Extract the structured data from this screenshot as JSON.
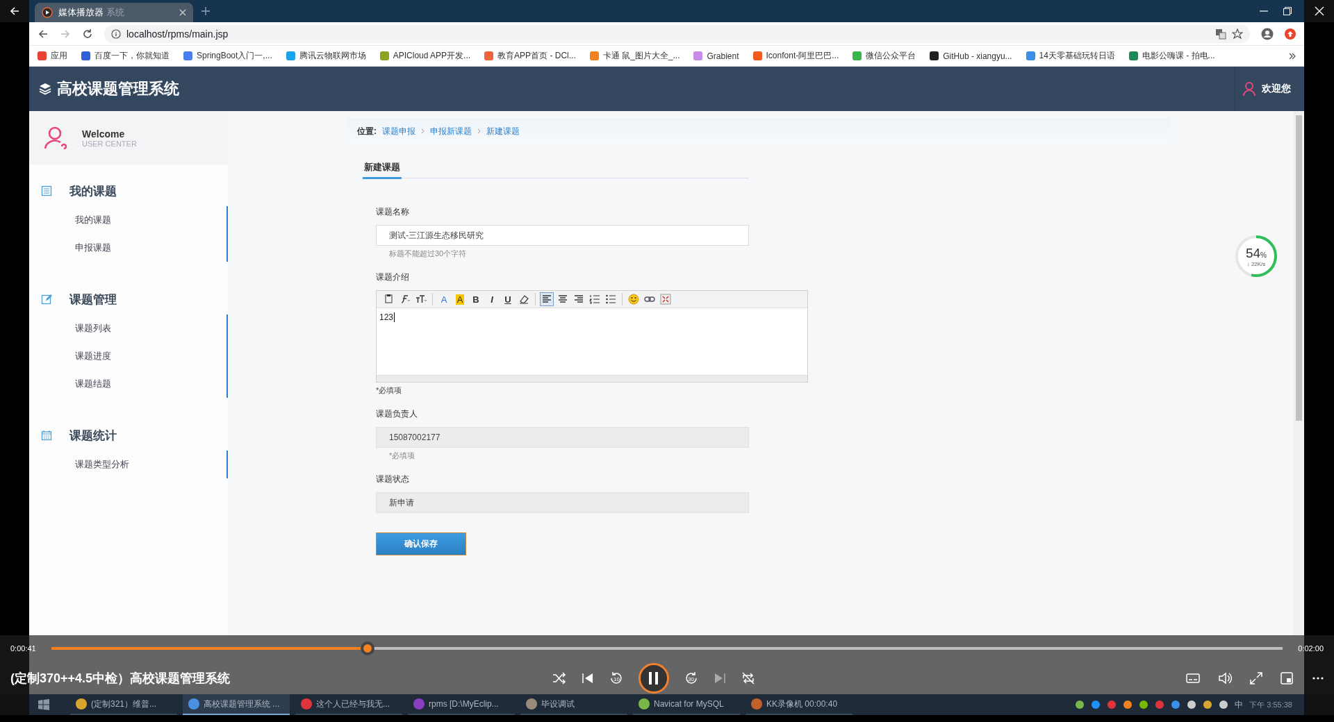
{
  "player": {
    "window_title": "媒体播放器",
    "tab_text_behind": "系统",
    "elapsed": "0:00:41",
    "duration": "0:02:00",
    "progress": {
      "level": 0.257
    },
    "video_title": "(定制370++4.5中检）高校课题管理系统",
    "playing": true,
    "rewind_seconds": "10",
    "forward_seconds": "30"
  },
  "browser": {
    "address": "localhost/rpms/main.jsp",
    "bookmarks": [
      {
        "label": "应用",
        "color": "#e94235"
      },
      {
        "label": "百度一下，你就知道",
        "color": "#2f5fd8"
      },
      {
        "label": "SpringBoot入门一,...",
        "color": "#4a7ef0"
      },
      {
        "label": "腾讯云物联网市场",
        "color": "#1aa3e8"
      },
      {
        "label": "APICloud APP开发...",
        "color": "#8fa321"
      },
      {
        "label": "教育APP首页 - DCl...",
        "color": "#f0643c"
      },
      {
        "label": "卡通 鼠_图片大全_...",
        "color": "#f2821f"
      },
      {
        "label": "Grabient",
        "color": "#c98be8"
      },
      {
        "label": "Iconfont-阿里巴巴...",
        "color": "#f25a1f"
      },
      {
        "label": "微信公众平台",
        "color": "#39b54a"
      },
      {
        "label": "GitHub - xiangyu...",
        "color": "#222222"
      },
      {
        "label": "14天零基础玩转日语",
        "color": "#3a8fe8"
      },
      {
        "label": "电影公嗨课 - 拍电...",
        "color": "#1a8a5a"
      }
    ]
  },
  "app": {
    "title": "高校课题管理系统",
    "user_greeting": "欢迎您",
    "welcome": "Welcome",
    "user_center": "USER CENTER",
    "sidebar": [
      {
        "title": "我的课题",
        "kind": "list",
        "items": [
          "我的课题",
          "申报课题"
        ]
      },
      {
        "title": "课题管理",
        "kind": "edit",
        "items": [
          "课题列表",
          "课题进度",
          "课题结题"
        ]
      },
      {
        "title": "课题统计",
        "kind": "calendar",
        "items": [
          "课题类型分析"
        ]
      }
    ],
    "breadcrumb": {
      "label": "位置:",
      "items": [
        "课题申报",
        "申报新课题",
        "新建课题"
      ]
    },
    "form_title": "新建课题",
    "fields": [
      {
        "kind": "input",
        "label": "课题名称",
        "value": "测试-三江源生态移民研究",
        "hint": "标题不能超过30个字符",
        "disabled": false
      },
      {
        "kind": "editor",
        "label": "课题介绍",
        "value": "123",
        "hint": "*必填项"
      },
      {
        "kind": "input",
        "label": "课题负责人",
        "value": "15087002177",
        "hint": "*必填项",
        "disabled": true
      },
      {
        "kind": "input",
        "label": "课题状态",
        "value": "新申请",
        "disabled": true
      }
    ],
    "toolbar": [
      {
        "kind": "paste",
        "selected": false
      },
      {
        "kind": "font-family",
        "selected": false
      },
      {
        "kind": "font-size",
        "selected": false
      },
      {
        "kind": "separator"
      },
      {
        "kind": "font-color",
        "glyph": "A",
        "selected": false
      },
      {
        "kind": "highlight",
        "glyph": "A",
        "selected": false
      },
      {
        "kind": "bold",
        "glyph": "B",
        "selected": false
      },
      {
        "kind": "italic",
        "glyph": "I",
        "selected": false
      },
      {
        "kind": "underline",
        "glyph": "U",
        "selected": false
      },
      {
        "kind": "eraser",
        "selected": false
      },
      {
        "kind": "separator"
      },
      {
        "kind": "align-left",
        "selected": true
      },
      {
        "kind": "align-center",
        "selected": false
      },
      {
        "kind": "align-right",
        "selected": false
      },
      {
        "kind": "ordered-list",
        "selected": false
      },
      {
        "kind": "unordered-list",
        "selected": false
      },
      {
        "kind": "separator"
      },
      {
        "kind": "emoji",
        "selected": false
      },
      {
        "kind": "link",
        "selected": false
      },
      {
        "kind": "fullscreen",
        "selected": false
      }
    ],
    "save_button": "确认保存"
  },
  "speed_widget": {
    "value": "54",
    "unit": "%",
    "level": 0.54,
    "speed": "↓ 22K/s"
  },
  "taskbar": {
    "items": [
      {
        "label": "(定制321）维普...",
        "color": "#d8a630",
        "selected": false
      },
      {
        "label": "高校课题管理系统 ...",
        "color": "#4a90e2",
        "selected": true
      },
      {
        "label": "这个人已经与我无...",
        "color": "#e0343c",
        "selected": false
      },
      {
        "label": "rpms [D:\\MyEclip...",
        "color": "#8a3fc0",
        "selected": false
      },
      {
        "label": "毕设调试",
        "color": "#9a8a7a",
        "selected": false
      },
      {
        "label": "Navicat for MySQL",
        "color": "#7ab648",
        "selected": false
      },
      {
        "label": "KK录像机 00:00:40",
        "color": "#c0602a",
        "selected": false
      }
    ],
    "ime": "中",
    "clock": "下午 3:55:38"
  }
}
